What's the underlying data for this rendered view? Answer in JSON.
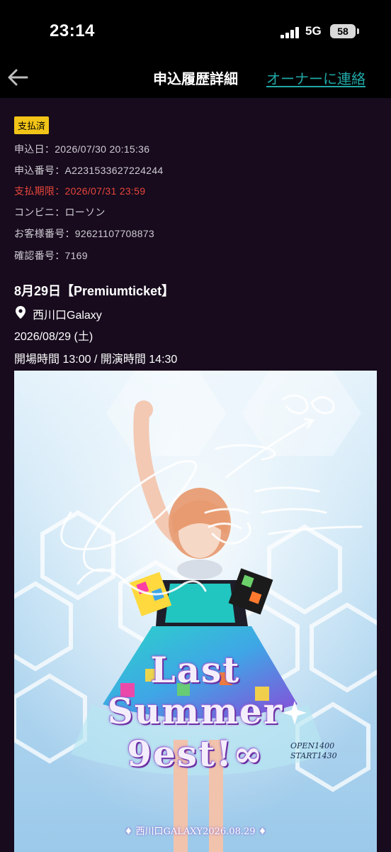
{
  "status_bar": {
    "time": "23:14",
    "network": "5G",
    "battery": "58"
  },
  "nav": {
    "back_icon": "arrow-left-icon",
    "title": "申込履歴詳細",
    "contact_link": "オーナーに連絡",
    "accent_color": "#20a8a6"
  },
  "order": {
    "status_badge": "支払済",
    "application_date": "申込日：2026/07/30 20:15:36",
    "application_number": "申込番号：A2231533627224244",
    "payment_deadline": "支払期限：2026/07/31 23:59",
    "convenience_store": "コンビニ：ローソン",
    "customer_number": "お客様番号：92621107708873",
    "confirmation_number": "確認番号：7169"
  },
  "event": {
    "title": "8月29日【Premiumticket】",
    "venue": "西川口Galaxy",
    "date": "2026/08/29 (土)",
    "time": "開場時間 13:00 / 開演時間 14:30"
  },
  "poster": {
    "title_line1": "Last",
    "title_line2": "Summer",
    "title_line3": "9est!∞",
    "open_time": "OPEN1400",
    "start_time": "START1430",
    "venue_date": "♦ 西川口GALAXY2026.08.29 ♦"
  }
}
